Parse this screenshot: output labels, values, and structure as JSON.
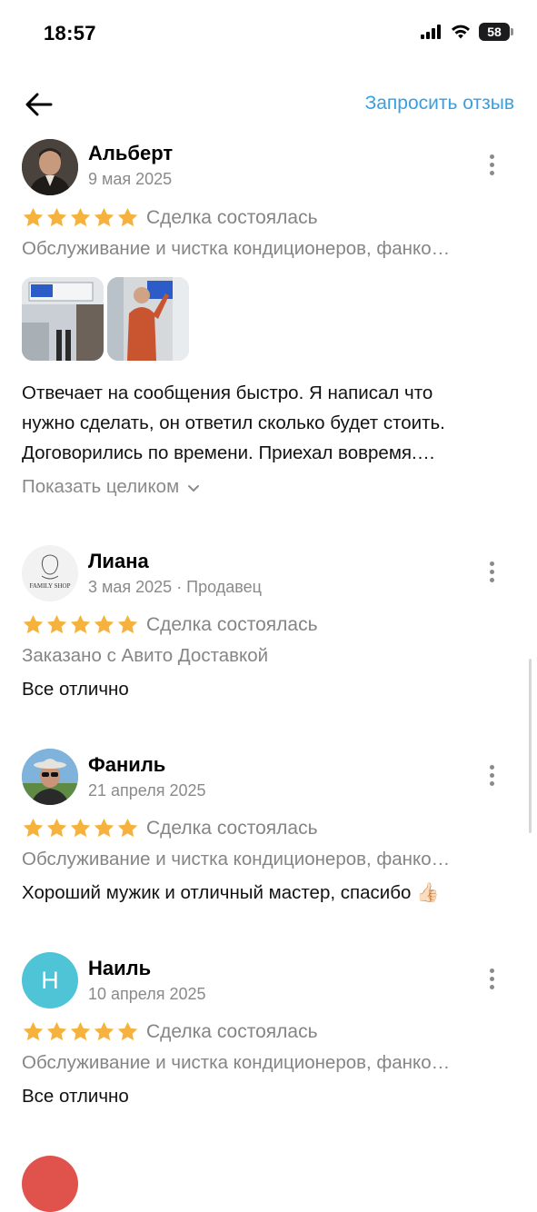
{
  "status_bar": {
    "time": "18:57",
    "battery": "58"
  },
  "nav": {
    "request_review": "Запросить отзыв"
  },
  "reviews": [
    {
      "name": "Альберт",
      "date": "9 мая 2025",
      "rating": 5,
      "deal_status": "Сделка состоялась",
      "service": "Обслуживание и чистка кондиционеров, фанко…",
      "text_lines": [
        "Отвечает на сообщения быстро. Я написал что",
        "нужно сделать, он ответил сколько будет стоить.",
        "Договорились по времени. Приехал вовремя.…"
      ],
      "show_more": "Показать целиком"
    },
    {
      "name": "Лиана",
      "date": "3 мая 2025 · Продавец",
      "avatar_text": "FAMILY SHOP",
      "rating": 5,
      "deal_status": "Сделка состоялась",
      "service": "Заказано с Авито Доставкой",
      "text": "Все отлично"
    },
    {
      "name": "Фаниль",
      "date": "21 апреля 2025",
      "rating": 5,
      "deal_status": "Сделка состоялась",
      "service": "Обслуживание и чистка кондиционеров, фанко…",
      "text": "Хороший мужик и отличный мастер, спасибо 👍🏻"
    },
    {
      "name": "Наиль",
      "date": "10 апреля 2025",
      "avatar_letter": "Н",
      "rating": 5,
      "deal_status": "Сделка состоялась",
      "service": "Обслуживание и чистка кондиционеров, фанко…",
      "text": "Все отлично"
    }
  ],
  "colors": {
    "accent": "#3a9fe0",
    "star": "#f5b33d",
    "avatar_nail": "#4fc4d6",
    "muted": "#858585"
  }
}
